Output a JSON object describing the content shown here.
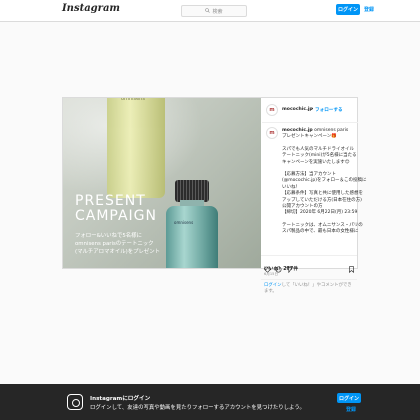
{
  "topbar": {
    "logo": "Instagram",
    "search_placeholder": "検索",
    "login_label": "ログイン",
    "signup_label": "登録"
  },
  "post": {
    "username": "mocochic.jp",
    "follow_label": "フォローする",
    "image": {
      "title_line1": "PRESENT",
      "title_line2": "CAMPAIGN",
      "desc_line1": "フォロー&いいねで5名様に",
      "desc_line2": "omnisens parisのテートニック",
      "desc_line3": "(マルチアロマオイル)をプレゼント",
      "bottle_label1": "omnisens",
      "bottle_label2": "omnisens"
    },
    "caption": {
      "author": "mocochic.jp",
      "lines": [
        "omnisens paris",
        "プレゼントキャンペーン🎁",
        "",
        "スパでも人気のマルチドライオイル",
        "テートニック(mini)が5名様に当たる",
        "キャンペーンを実施いたします😊",
        "",
        "【応募方法】当アカウント",
        "(@mocochic.jp)をフォロー＆この投稿に",
        "いいね！",
        "【応募条件】写真と共に使用した感想を",
        "アップしていただける方(日本在住の方)",
        "公開アカウントの方",
        "【締切】2020年 6月22日(月) 23:59",
        "",
        "テートニックは、オムニサンス・パリの",
        "スパ製品の中で、最も日本の女性様に"
      ]
    },
    "likes": "いいね！277件",
    "date": "6月15日",
    "login_note_link": "ログイン",
    "login_note_text": "して「いいね！」やコメントができます。"
  },
  "bottombar": {
    "title": "Instagramにログイン",
    "desc": "ログインして、友達の写真や動画を見たりフォローするアカウントを見つけたりしよう。",
    "login_label": "ログイン",
    "signup_label": "登録"
  },
  "colors": {
    "accent": "#0095f6",
    "bottom_bar": "#262626",
    "border": "#dbdbdb"
  }
}
